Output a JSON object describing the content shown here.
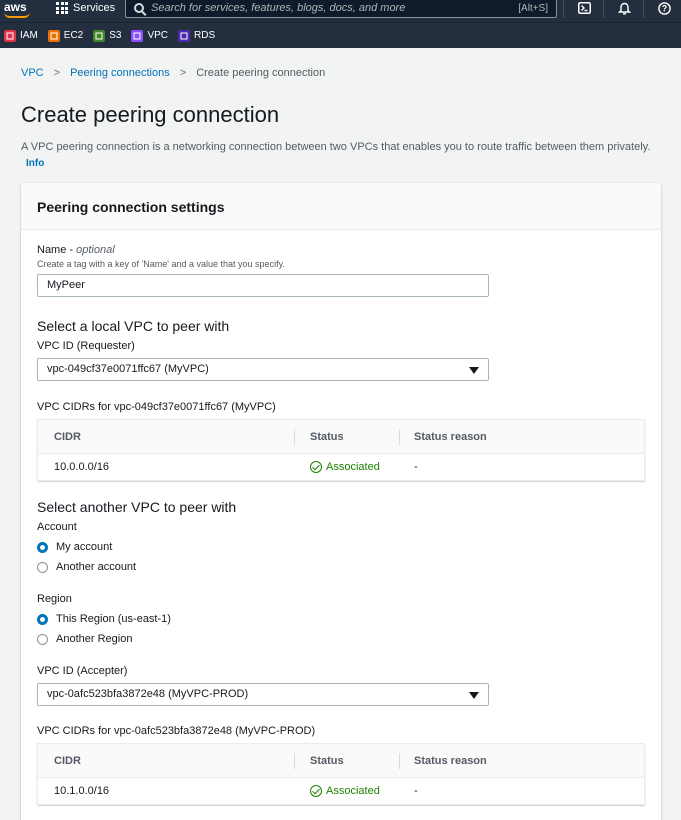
{
  "topnav": {
    "logo": "aws",
    "services_label": "Services",
    "search_placeholder": "Search for services, features, blogs, docs, and more",
    "search_shortcut": "[Alt+S]"
  },
  "favorites": [
    {
      "label": "IAM",
      "color": "#dd344c"
    },
    {
      "label": "EC2",
      "color": "#ed7100"
    },
    {
      "label": "S3",
      "color": "#3f8624"
    },
    {
      "label": "VPC",
      "color": "#8c4fff"
    },
    {
      "label": "RDS",
      "color": "#4d27aa"
    }
  ],
  "breadcrumb": {
    "items": [
      "VPC",
      "Peering connections"
    ],
    "current": "Create peering connection"
  },
  "page": {
    "title": "Create peering connection",
    "description": "A VPC peering connection is a networking connection between two VPCs that enables you to route traffic between them privately.",
    "info_link": "Info"
  },
  "panel": {
    "title": "Peering connection settings",
    "name_label": "Name",
    "name_optional": "optional",
    "name_hint": "Create a tag with a key of 'Name' and a value that you specify.",
    "name_value": "MyPeer",
    "local_heading": "Select a local VPC to peer with",
    "requester_label": "VPC ID (Requester)",
    "requester_value": "vpc-049cf37e0071ffc67 (MyVPC)",
    "local_cidrs_label": "VPC CIDRs for vpc-049cf37e0071ffc67 (MyVPC)",
    "table_headers": [
      "CIDR",
      "Status",
      "Status reason"
    ],
    "local_cidr_row": {
      "cidr": "10.0.0.0/16",
      "status": "Associated",
      "reason": "-"
    },
    "another_heading": "Select another VPC to peer with",
    "account_label": "Account",
    "account_options": [
      "My account",
      "Another account"
    ],
    "region_label": "Region",
    "region_options": [
      "This Region (us-east-1)",
      "Another Region"
    ],
    "accepter_label": "VPC ID (Accepter)",
    "accepter_value": "vpc-0afc523bfa3872e48 (MyVPC-PROD)",
    "peer_cidrs_label": "VPC CIDRs for vpc-0afc523bfa3872e48 (MyVPC-PROD)",
    "peer_cidr_row": {
      "cidr": "10.1.0.0/16",
      "status": "Associated",
      "reason": "-"
    }
  }
}
